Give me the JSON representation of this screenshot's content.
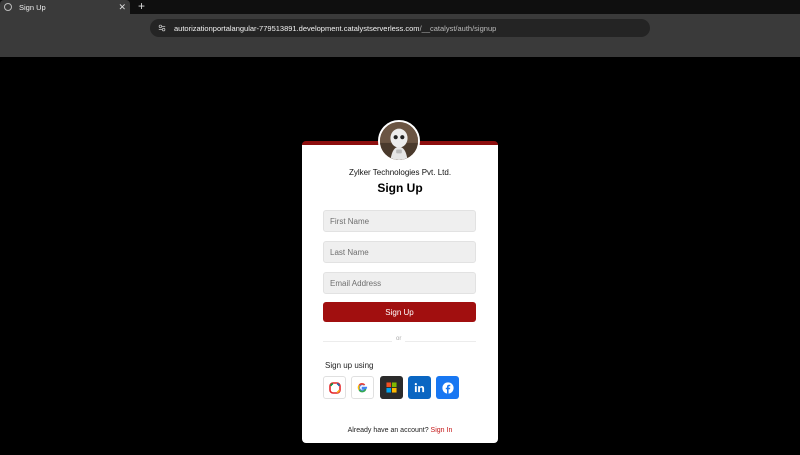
{
  "browser": {
    "tab_title": "Sign Up",
    "tab_close": "✕",
    "new_tab": "+",
    "url_host": "autorizationportalangular-779513891.development.catalystserverless.com",
    "url_path": "/__catalyst/auth/signup"
  },
  "card": {
    "company": "Zylker Technologies Pvt. Ltd.",
    "heading": "Sign Up",
    "fields": {
      "first_name_placeholder": "First Name",
      "last_name_placeholder": "Last Name",
      "email_placeholder": "Email Address"
    },
    "signup_button": "Sign Up",
    "divider_text": "or",
    "signup_using": "Sign up using",
    "social_providers": [
      "zoho-icon",
      "google-icon",
      "microsoft-icon",
      "linkedin-icon",
      "facebook-icon"
    ],
    "footer_text": "Already have an account?",
    "footer_link": "Sign In"
  },
  "colors": {
    "accent": "#a10f0f",
    "link": "#c41515",
    "linkedin": "#0a66c2",
    "facebook": "#1877f2"
  }
}
